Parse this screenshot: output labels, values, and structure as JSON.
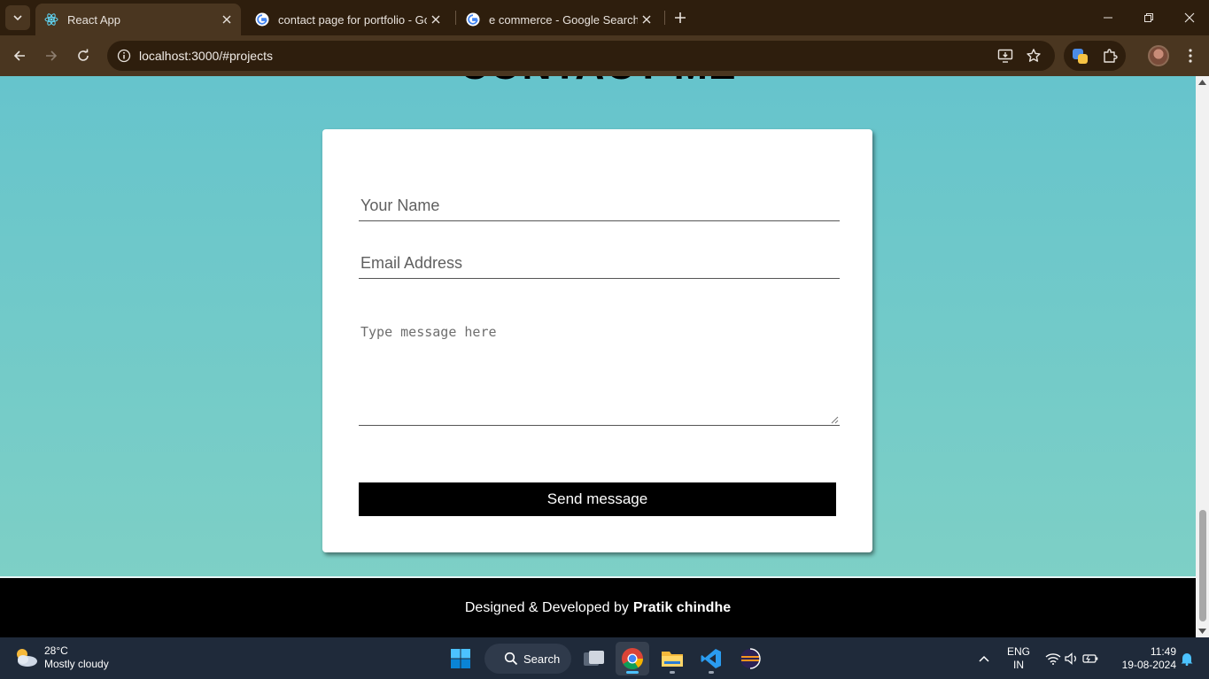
{
  "browser": {
    "tabs": [
      {
        "title": "React App",
        "favicon": "react-icon",
        "active": true
      },
      {
        "title": "contact page for portfolio - Goo",
        "favicon": "google-icon",
        "active": false
      },
      {
        "title": "e commerce - Google Search",
        "favicon": "google-icon",
        "active": false
      }
    ],
    "url": "localhost:3000/#projects"
  },
  "page": {
    "heading": "CONTACT ME",
    "form": {
      "name_placeholder": "Your Name",
      "email_placeholder": "Email Address",
      "message_placeholder": "Type message here",
      "submit_label": "Send message"
    },
    "footer": {
      "prefix": "Designed & Developed by",
      "author": "Pratik chindhe"
    },
    "colors": {
      "background_top": "#66c4cc",
      "background_bottom": "#80d1c5",
      "button": "#000000",
      "footer": "#000000"
    }
  },
  "taskbar": {
    "weather": {
      "temp": "28°C",
      "condition": "Mostly cloudy"
    },
    "search_label": "Search",
    "language": {
      "line1": "ENG",
      "line2": "IN"
    },
    "clock": {
      "time": "11:49",
      "date": "19-08-2024"
    }
  }
}
